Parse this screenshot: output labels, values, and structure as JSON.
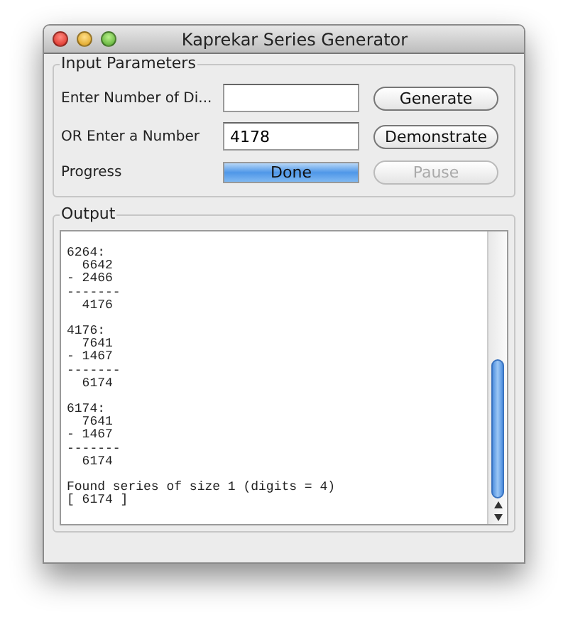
{
  "window": {
    "title": "Kaprekar Series Generator"
  },
  "input_parameters": {
    "title": "Input Parameters",
    "rows": [
      {
        "label": "Enter Number of Di...",
        "field": {},
        "button": {
          "label": "Generate",
          "disabled": false
        }
      },
      {
        "label": "OR Enter a Number",
        "field": {
          "value": "4178"
        },
        "button": {
          "label": "Demonstrate",
          "disabled": false
        }
      },
      {
        "label": "Progress",
        "progress": {
          "level": 1,
          "text": "Done"
        },
        "button": {
          "label": "Pause",
          "disabled": true
        }
      }
    ]
  },
  "output": {
    "title": "Output",
    "blocks": [
      [
        "6264:",
        "  6642",
        "- 2466",
        "-------",
        "  4176"
      ],
      [
        "4176:",
        "  7641",
        "- 1467",
        "-------",
        "  6174"
      ],
      [
        "6174:",
        "  7641",
        "- 1467",
        "-------",
        "  6174"
      ],
      [
        "Found series of size 1 (digits = 4)",
        "[ 6174 ]"
      ]
    ]
  }
}
